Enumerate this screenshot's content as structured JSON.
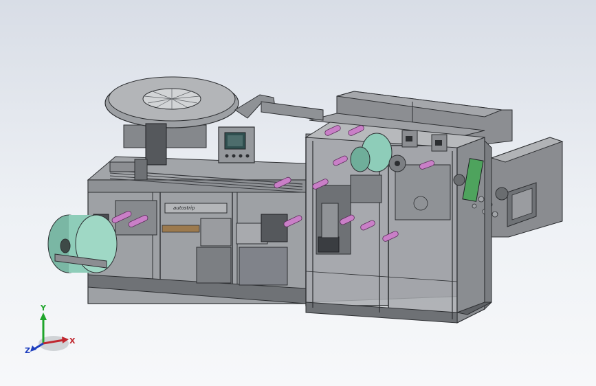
{
  "viewport": {
    "background_top": "#d8dde6",
    "background_bottom": "#f7f8fa"
  },
  "model": {
    "panel_label": "autostrip",
    "colors": {
      "frame": "#7d7f82",
      "glass": "#a9acb0",
      "glass_dark": "#8e9196",
      "edge": "#2c2e31",
      "roller": "#c97fc7",
      "film_roll": "#8ecdb9",
      "screen": "#2f4f4f"
    }
  },
  "triad": {
    "x_label": "X",
    "y_label": "Y",
    "z_label": "Z",
    "x_color": "#c0262e",
    "y_color": "#1fa52b",
    "z_color": "#1f3fbf"
  }
}
